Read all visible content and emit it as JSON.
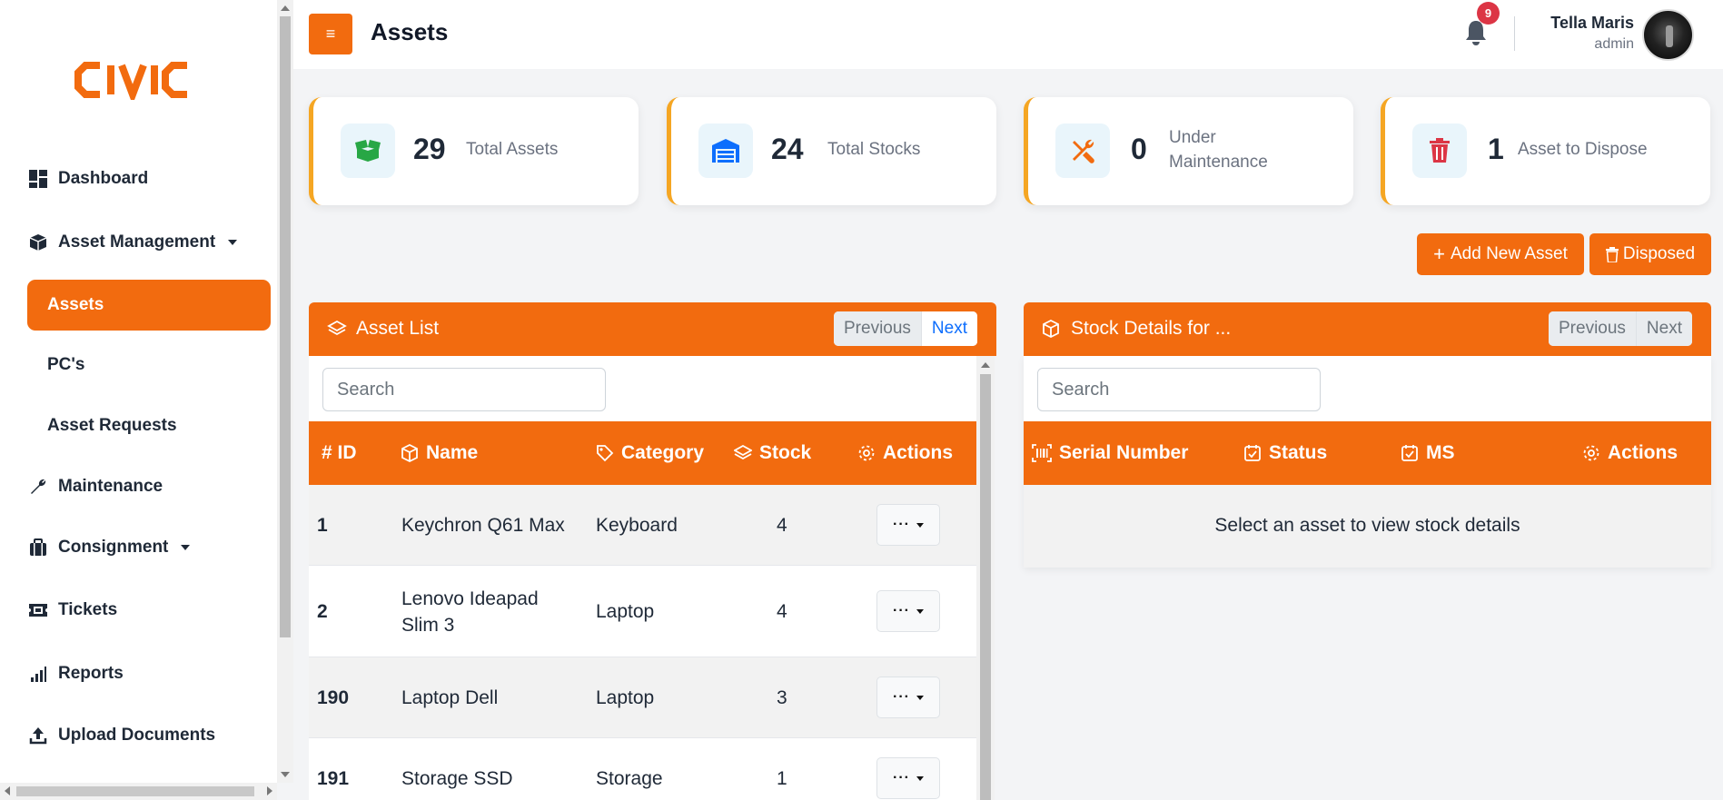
{
  "app": {
    "logo_text": "CIVIC",
    "brand_color": "#f26b0f"
  },
  "sidebar": {
    "items": [
      {
        "label": "Dashboard",
        "icon": "dashboard-icon"
      },
      {
        "label": "Asset Management",
        "icon": "box-icon",
        "expandable": true
      },
      {
        "label": "Assets",
        "active": true
      },
      {
        "label": "PC's"
      },
      {
        "label": "Asset Requests"
      },
      {
        "label": "Maintenance",
        "icon": "wrench-icon"
      },
      {
        "label": "Consignment",
        "icon": "briefcase-icon",
        "expandable": true
      },
      {
        "label": "Tickets",
        "icon": "ticket-icon"
      },
      {
        "label": "Reports",
        "icon": "bar-chart-icon"
      },
      {
        "label": "Upload Documents",
        "icon": "upload-icon"
      }
    ]
  },
  "header": {
    "menu_icon": "≡",
    "title": "Assets",
    "notification_count": "9",
    "user_name": "Tella Maris",
    "user_role": "admin"
  },
  "stats": [
    {
      "value": "29",
      "label": "Total Assets",
      "icon": "box-open-icon",
      "icon_color": "#28a745"
    },
    {
      "value": "24",
      "label": "Total Stocks",
      "icon": "warehouse-icon",
      "icon_color": "#0d6efd"
    },
    {
      "value": "0",
      "label": "Under Maintenance",
      "icon": "tools-icon",
      "icon_color": "#f26b0f"
    },
    {
      "value": "1",
      "label": "Asset to Dispose",
      "icon": "trash-icon",
      "icon_color": "#dc3545"
    }
  ],
  "actions": {
    "add_new": "Add New Asset",
    "disposed": "Disposed"
  },
  "asset_list": {
    "title": "Asset List",
    "prev": "Previous",
    "next": "Next",
    "search_placeholder": "Search",
    "columns": {
      "id": "# ID",
      "name": "Name",
      "category": "Category",
      "stock": "Stock",
      "actions": "Actions"
    },
    "rows": [
      {
        "id": "1",
        "name": "Keychron Q61 Max",
        "category": "Keyboard",
        "stock": "4"
      },
      {
        "id": "2",
        "name": "Lenovo Ideapad Slim 3",
        "category": "Laptop",
        "stock": "4"
      },
      {
        "id": "190",
        "name": "Laptop Dell",
        "category": "Laptop",
        "stock": "3"
      },
      {
        "id": "191",
        "name": "Storage SSD",
        "category": "Storage",
        "stock": "1"
      }
    ],
    "action_label": "···"
  },
  "stock_details": {
    "title": "Stock Details for ...",
    "prev": "Previous",
    "next": "Next",
    "search_placeholder": "Search",
    "columns": {
      "serial": "Serial Number",
      "status": "Status",
      "ms": "MS",
      "actions": "Actions"
    },
    "empty_message": "Select an asset to view stock details"
  }
}
